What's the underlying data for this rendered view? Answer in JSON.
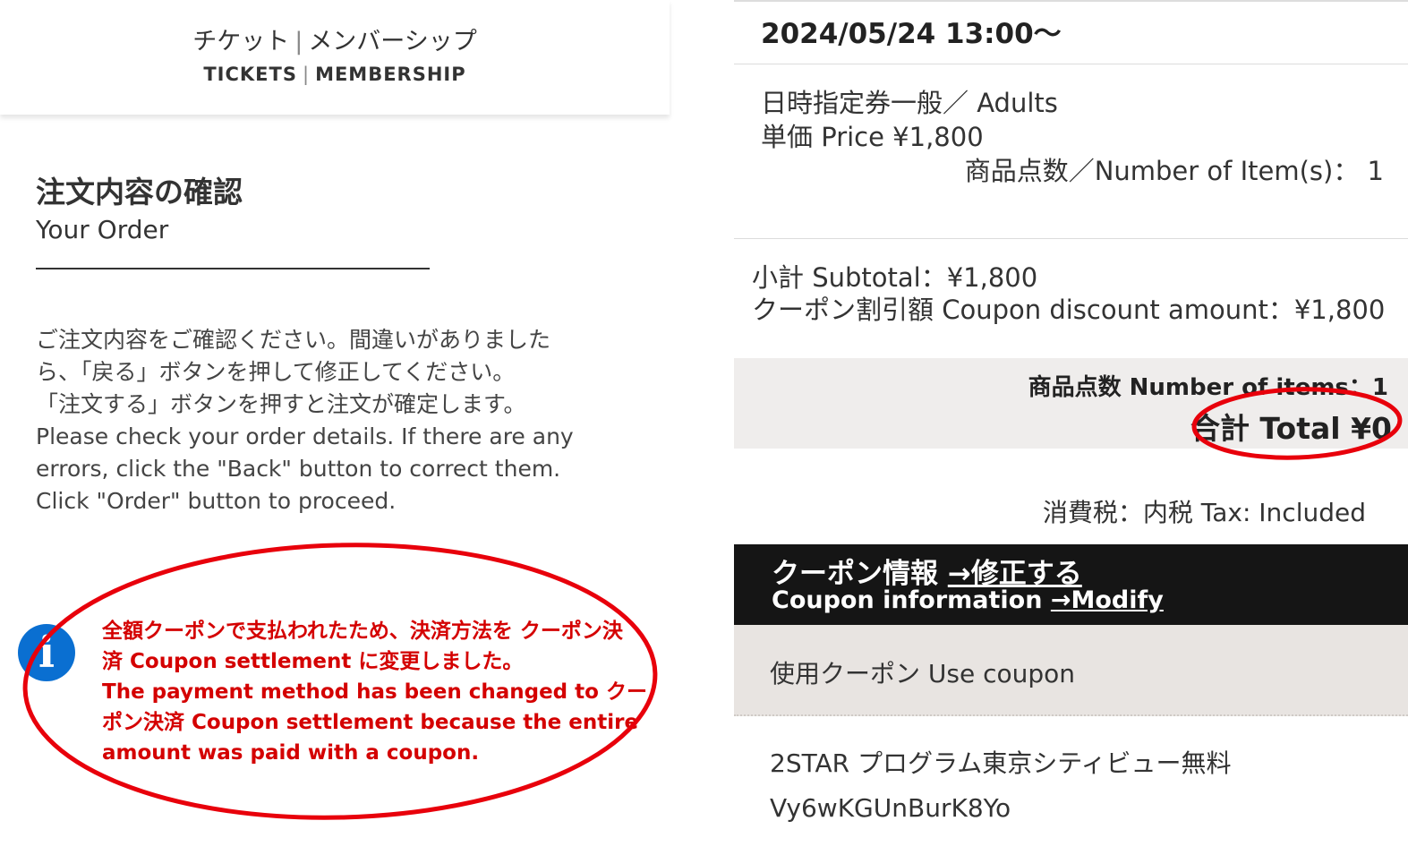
{
  "header": {
    "nav_jp_tickets": "チケット",
    "nav_jp_membership": "メンバーシップ",
    "nav_en_tickets": "TICKETS",
    "nav_en_membership": "MEMBERSHIP",
    "separator": "|"
  },
  "order": {
    "title_jp": "注文内容の確認",
    "title_en": "Your Order",
    "instructions": [
      "ご注文内容をご確認ください。間違いがありました",
      "ら、「戻る」ボタンを押して修正してください。",
      "「注文する」ボタンを押すと注文が確定します。",
      "Please check your order details. If there are any",
      "errors, click the \"Back\" button to correct them.",
      "Click \"Order\" button to proceed."
    ]
  },
  "notice": {
    "icon": "info-icon",
    "icon_glyph": "i",
    "lines": [
      "全額クーポンで支払われたため、決済方法を クーポン決",
      "済 Coupon settlement に変更しました。",
      "The payment method has been changed to クー",
      "ポン決済 Coupon settlement because the entire",
      "amount was paid with a coupon."
    ]
  },
  "summary": {
    "datetime": "2024/05/24 13:00〜",
    "item_name": "日時指定券一般／ Adults",
    "unit_price": "単価 Price ¥1,800",
    "item_count": "商品点数／Number of Item(s)： 1",
    "subtotal": "小計 Subtotal：¥1,800",
    "coupon_discount": "クーポン割引額 Coupon discount amount：¥1,800",
    "items_count_total": "商品点数 Number of items：1",
    "grand_total": "合計 Total ¥0",
    "tax": "消費税：内税 Tax: Included"
  },
  "coupon": {
    "title_jp": "クーポン情報 ",
    "modify_jp": "→修正する",
    "title_en": "Coupon information ",
    "modify_en": "→Modify",
    "use_label": "使用クーポン Use coupon",
    "coupon_name": "2STAR プログラム東京シティビュー無料",
    "coupon_code": "Vy6wKGUnBurK8Yo"
  },
  "colors": {
    "annotation_red": "#e8000b",
    "notice_red": "#d40000",
    "info_blue": "#0a6fd1",
    "coupon_header_bg": "#151515",
    "total_box_bg": "#efedec"
  }
}
